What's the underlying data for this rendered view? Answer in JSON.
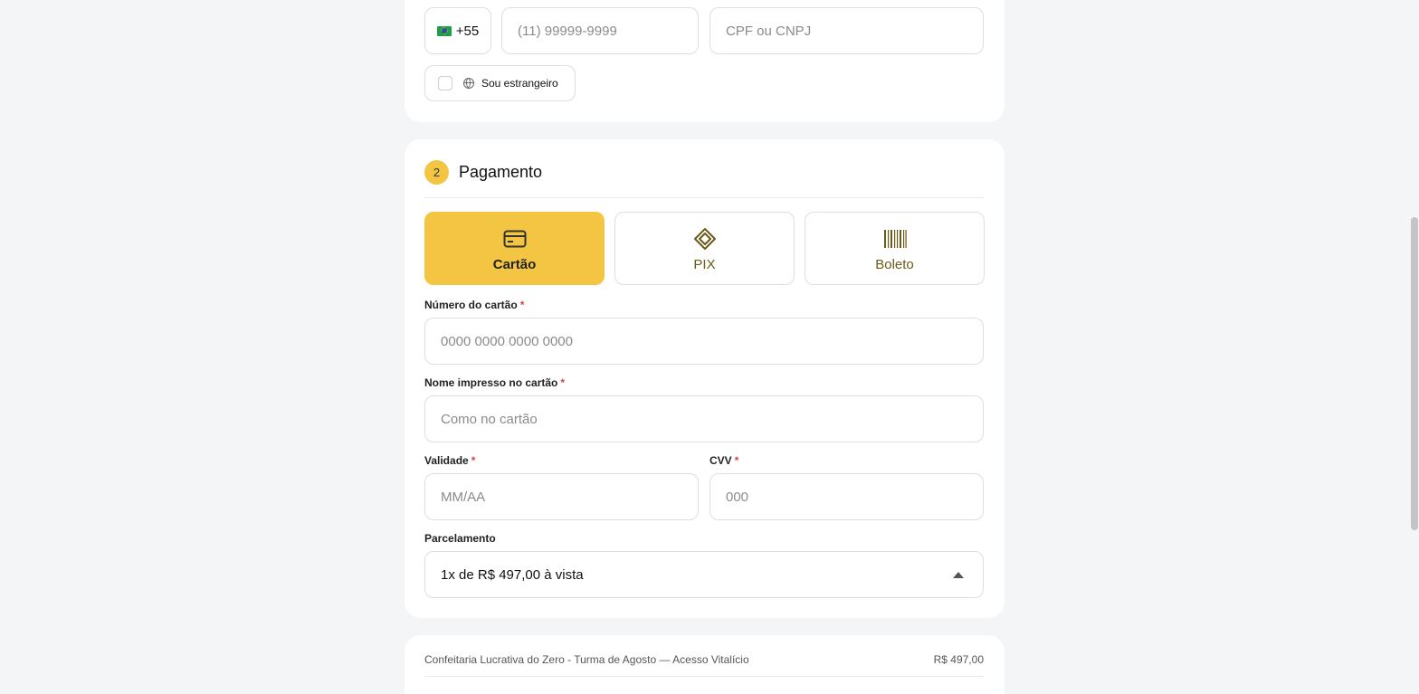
{
  "contact": {
    "ddi_code": "+55",
    "phone_placeholder": "(11) 99999-9999",
    "document_placeholder": "CPF ou CNPJ",
    "foreign_label": "Sou estrangeiro"
  },
  "payment": {
    "step_number": "2",
    "title": "Pagamento",
    "methods": [
      {
        "label": "Cartão",
        "icon": "credit-card-icon",
        "selected": true
      },
      {
        "label": "PIX",
        "icon": "pix-icon",
        "selected": false
      },
      {
        "label": "Boleto",
        "icon": "barcode-icon",
        "selected": false
      }
    ],
    "card_number": {
      "label": "Número do cartão",
      "required": "*",
      "placeholder": "0000 0000 0000 0000"
    },
    "card_name": {
      "label": "Nome impresso no cartão",
      "required": "*",
      "placeholder": "Como no cartão"
    },
    "expiry": {
      "label": "Validade",
      "required": "*",
      "placeholder": "MM/AA"
    },
    "cvv": {
      "label": "CVV",
      "required": "*",
      "placeholder": "000"
    },
    "installments": {
      "label": "Parcelamento",
      "selected": "1x de R$ 497,00 à vista"
    }
  },
  "summary": {
    "product": "Confeitaria Lucrativa do Zero - Turma de Agosto — Acesso Vitalício",
    "price": "R$ 497,00"
  },
  "colors": {
    "accent": "#f4c542",
    "method_text": "#6b5a18",
    "background": "#f4f5f7",
    "required": "#d64545"
  }
}
